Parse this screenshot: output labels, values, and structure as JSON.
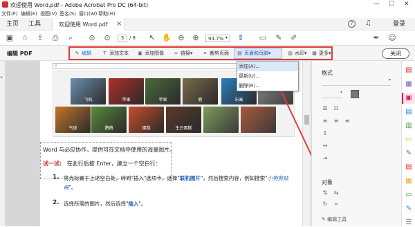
{
  "window": {
    "title": "欢迎使用 Word.pdf - Adobe Acrobat Pro DC (64-bit)",
    "minimize": "—",
    "maximize": "☐",
    "close": "✕"
  },
  "menubar": [
    "文件(F)",
    "编辑(E)",
    "视图(V)",
    "签名(S)",
    "窗口(W)",
    "帮助(H)"
  ],
  "tabs": {
    "home": "主页",
    "tools": "工具",
    "document": "欢迎使用 Word.pdf",
    "document_close": "×",
    "signin": "登录"
  },
  "toolbar": {
    "page_current": "3",
    "page_total": "/ 8",
    "zoom": "94.7%"
  },
  "editbar": {
    "title": "编辑 PDF",
    "buttons": [
      {
        "label": "编辑",
        "icon": "edit-icon"
      },
      {
        "label": "添加文本",
        "icon": "text-icon"
      },
      {
        "label": "添加图像",
        "icon": "image-icon"
      },
      {
        "label": "链接",
        "icon": "link-icon"
      },
      {
        "label": "裁剪页面",
        "icon": "crop-icon"
      },
      {
        "label": "页眉和页脚",
        "icon": "header-footer-icon"
      },
      {
        "label": "水印",
        "icon": "watermark-icon"
      },
      {
        "label": "更多",
        "icon": "more-icon"
      }
    ],
    "close": "关闭"
  },
  "dropdown": {
    "items": [
      "添加(A)...",
      "更新(U)...",
      "删除(R)..."
    ]
  },
  "document": {
    "thumbnails": [
      {
        "caption": "飞机",
        "color": "#6d8fb0"
      },
      {
        "caption": "苹果",
        "color": "#b0302a"
      },
      {
        "caption": "苹果",
        "color": "#4d6a3a"
      },
      {
        "caption": "鹿",
        "color": "#7a6a4a"
      },
      {
        "caption": "乐高",
        "color": "#2a7fc0"
      },
      {
        "caption": "气球",
        "color": "#c4762a"
      },
      {
        "caption": "鹦鹉",
        "color": "#5a8a3a"
      },
      {
        "caption": "蛋糕",
        "color": "#c84f2a"
      },
      {
        "caption": "生日蛋糕",
        "color": "#5a3a2a"
      }
    ],
    "para1": "Word 与必应协作，提供可在文档中使用的海量图片。",
    "try_label": "试一试:",
    "try_text": "在此行后按 Enter，建立一个空白行：",
    "step1_num": "1.",
    "step1_text": "将光标置于上述空白处，转到\"插入\"选项卡，选择\"",
    "step1_bold": "联机图片",
    "step1_text2": "\"，然后搜索内容，例如搜索\"",
    "step1_link": "小狗剪贴画",
    "step1_text3": "\"。",
    "step2_num": "2.",
    "step2_text": "选择所需的图片，然后选择\"",
    "step2_bold": "插入",
    "step2_text2": "\"。"
  },
  "rightpane": {
    "format_label": "格式",
    "objects_label": "对象",
    "edit_tools": "编辑工具"
  },
  "colors": {
    "accent_red": "#e53935",
    "acrobat_blue": "#1473e6",
    "link_blue": "#1e5fb5",
    "try_red": "#c62828"
  }
}
